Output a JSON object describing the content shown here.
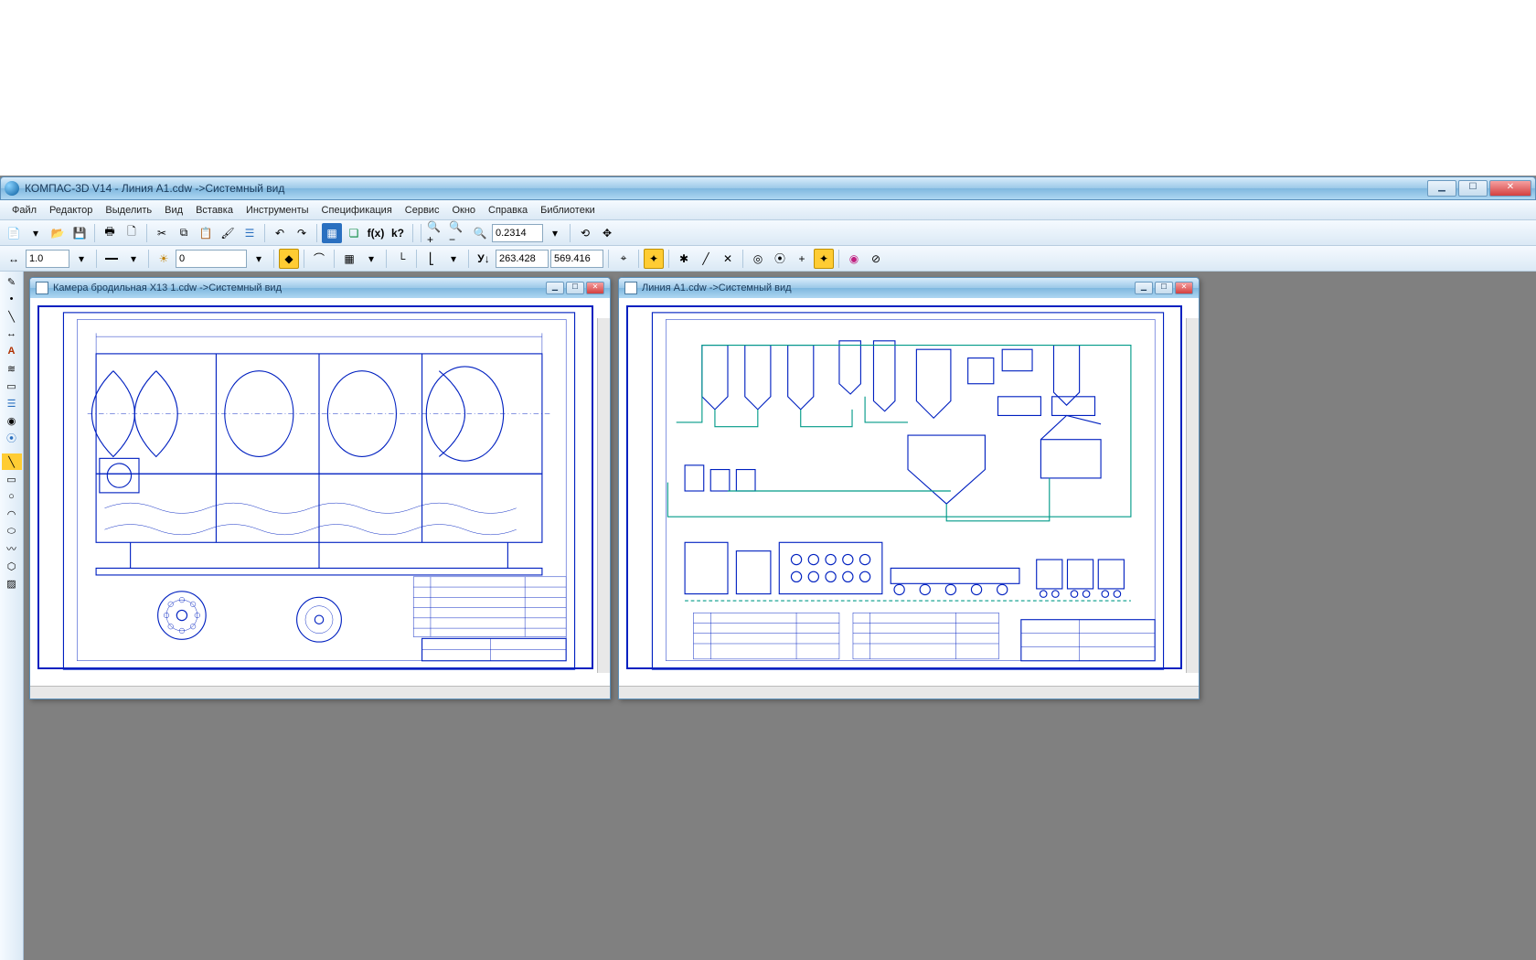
{
  "app": {
    "name": "КОМПАС-3D V14",
    "active_doc": "Линия A1.cdw ->Системный вид"
  },
  "menu": [
    "Файл",
    "Редактор",
    "Выделить",
    "Вид",
    "Вставка",
    "Инструменты",
    "Спецификация",
    "Сервис",
    "Окно",
    "Справка",
    "Библиотеки"
  ],
  "toolbar2": {
    "scale": "1.0",
    "layer": "0",
    "zoom": "0.2314",
    "coord_x": "263.428",
    "coord_y": "569.416"
  },
  "documents": [
    {
      "title": "Камера бродильная Х13 1.cdw ->Системный вид"
    },
    {
      "title": "Линия A1.cdw ->Системный вид"
    }
  ],
  "window_controls": {
    "min": "▁",
    "max": "☐",
    "close": "✕"
  }
}
